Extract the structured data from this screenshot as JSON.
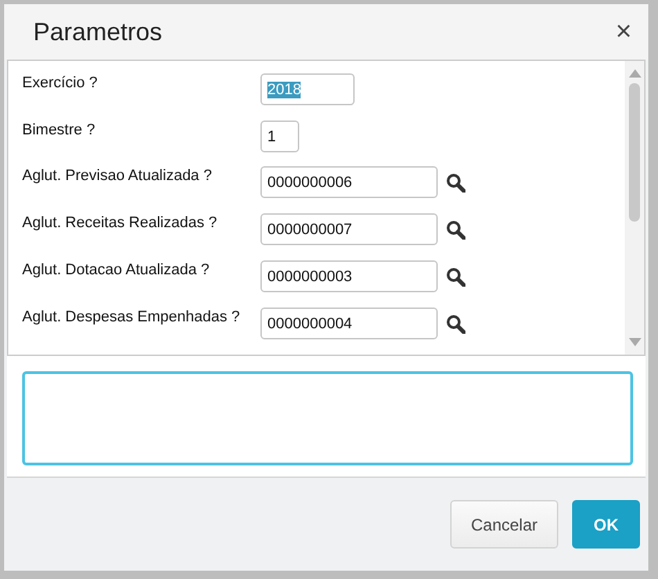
{
  "dialog": {
    "title": "Parametros",
    "close": "×"
  },
  "fields": [
    {
      "label": "Exercício ?",
      "value": "2018",
      "kind": "short",
      "highlighted": true
    },
    {
      "label": "Bimestre ?",
      "value": "1",
      "kind": "tiny",
      "highlighted": false
    },
    {
      "label": "Aglut. Previsao Atualizada ?",
      "value": "0000000006",
      "kind": "lookup",
      "highlighted": false
    },
    {
      "label": "Aglut. Receitas Realizadas ?",
      "value": "0000000007",
      "kind": "lookup",
      "highlighted": false
    },
    {
      "label": "Aglut. Dotacao Atualizada ?",
      "value": "0000000003",
      "kind": "lookup",
      "highlighted": false
    },
    {
      "label": "Aglut. Despesas Empenhadas ?",
      "value": "0000000004",
      "kind": "lookup",
      "highlighted": false
    }
  ],
  "buttons": [
    {
      "label": "Cancelar",
      "kind": "secondary"
    },
    {
      "label": "OK",
      "kind": "primary"
    }
  ]
}
